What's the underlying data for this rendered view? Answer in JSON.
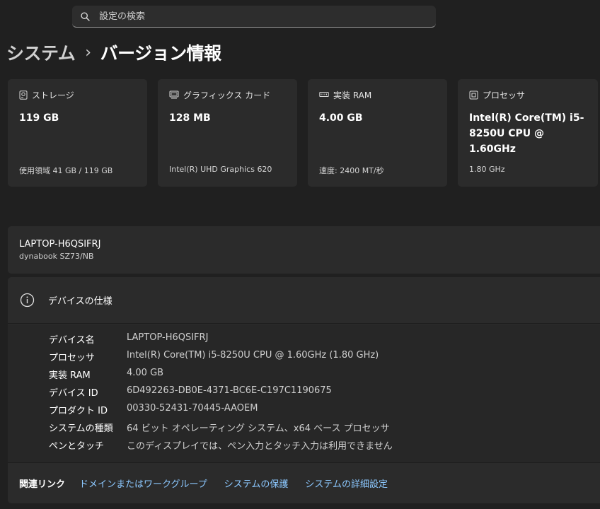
{
  "search": {
    "placeholder": "設定の検索"
  },
  "breadcrumb": {
    "parent": "システム",
    "separator": "›",
    "current": "バージョン情報"
  },
  "cards": [
    {
      "title": "ストレージ",
      "icon": "storage-icon",
      "value": "119 GB",
      "sub": "使用領域 41 GB / 119 GB"
    },
    {
      "title": "グラフィックス カード",
      "icon": "graphics-card-icon",
      "value": "128 MB",
      "sub": "Intel(R) UHD Graphics 620"
    },
    {
      "title": "実装 RAM",
      "icon": "ram-icon",
      "value": "4.00 GB",
      "sub": "速度: 2400 MT/秒"
    },
    {
      "title": "プロセッサ",
      "icon": "processor-icon",
      "value": "Intel(R) Core(TM) i5-8250U CPU @ 1.60GHz",
      "sub": "1.80 GHz"
    }
  ],
  "device": {
    "name": "LAPTOP-H6QSIFRJ",
    "model": "dynabook SZ73/NB"
  },
  "specs": {
    "title": "デバイスの仕様",
    "icon": "info-icon",
    "rows": [
      {
        "label": "デバイス名",
        "value": "LAPTOP-H6QSIFRJ"
      },
      {
        "label": "プロセッサ",
        "value": "Intel(R) Core(TM) i5-8250U CPU @ 1.60GHz (1.80 GHz)"
      },
      {
        "label": "実装 RAM",
        "value": "4.00 GB"
      },
      {
        "label": "デバイス ID",
        "value": "6D492263-DB0E-4371-BC6E-C197C1190675"
      },
      {
        "label": "プロダクト ID",
        "value": "00330-52431-70445-AAOEM"
      },
      {
        "label": "システムの種類",
        "value": "64 ビット オペレーティング システム、x64 ベース プロセッサ"
      },
      {
        "label": "ペンとタッチ",
        "value": "このディスプレイでは、ペン入力とタッチ入力は利用できません"
      }
    ]
  },
  "related": {
    "title": "関連リンク",
    "links": [
      "ドメインまたはワークグループ",
      "システムの保護",
      "システムの詳細設定"
    ]
  },
  "colors": {
    "background": "#202020",
    "card": "#2b2b2b",
    "link": "#8cc8ff"
  }
}
